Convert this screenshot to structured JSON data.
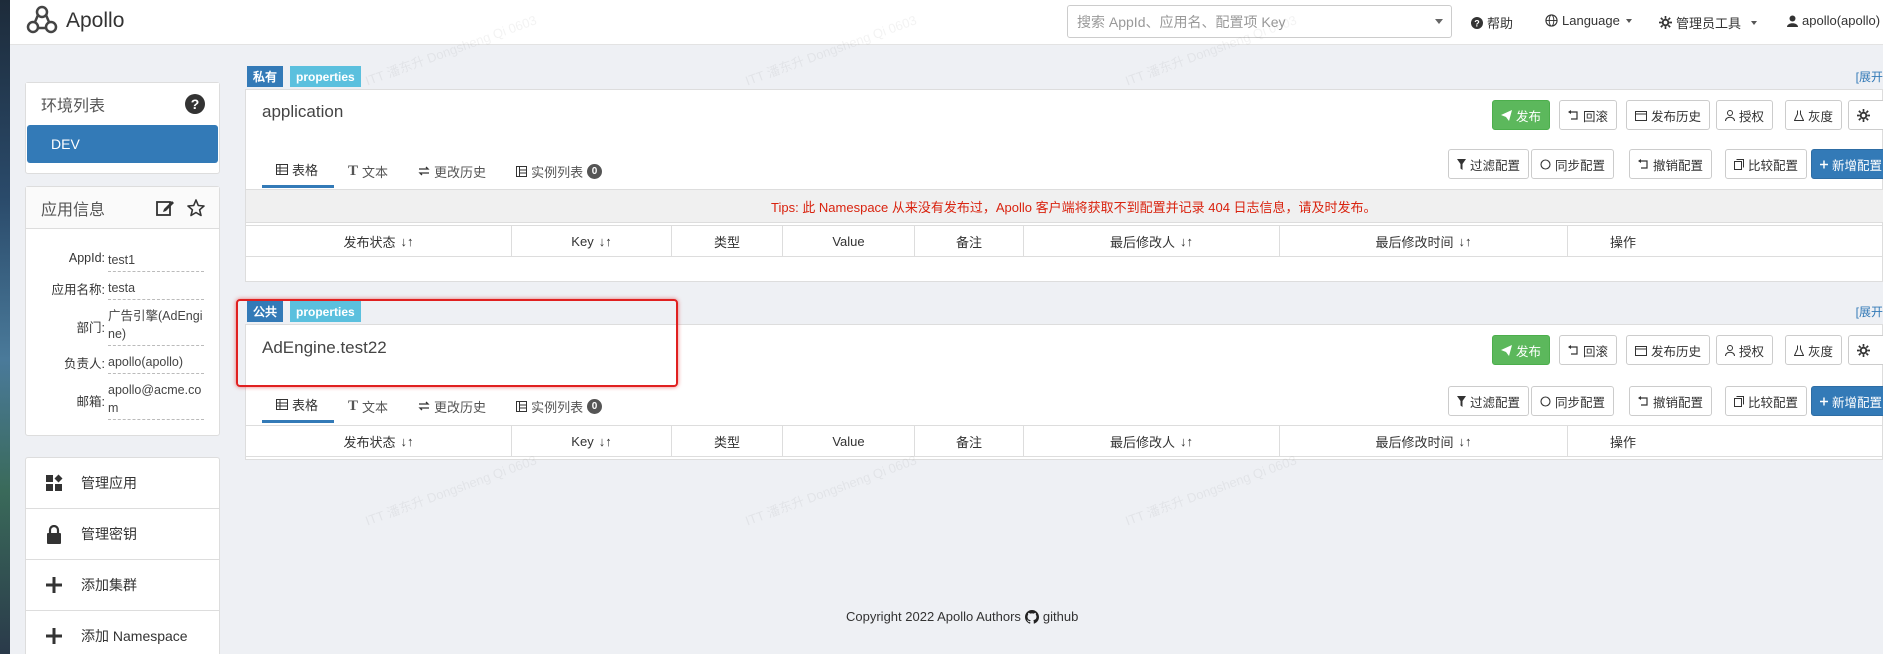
{
  "app": {
    "name": "Apollo"
  },
  "search": {
    "placeholder": "搜索 AppId、应用名、配置项 Key"
  },
  "topnav": {
    "help": "帮助",
    "language": "Language",
    "admin_tools": "管理员工具",
    "user": "apollo(apollo)"
  },
  "env_panel": {
    "title": "环境列表",
    "envs": [
      "DEV"
    ]
  },
  "app_info": {
    "title": "应用信息",
    "rows": [
      {
        "label": "AppId:",
        "value": "test1"
      },
      {
        "label": "应用名称:",
        "value": "testa"
      },
      {
        "label": "部门:",
        "value": "广告引擎(AdEngine)"
      },
      {
        "label": "负责人:",
        "value": "apollo(apollo)"
      },
      {
        "label": "邮箱:",
        "value": "apollo@acme.com"
      }
    ]
  },
  "side_menu": [
    "管理应用",
    "管理密钥",
    "添加集群",
    "添加 Namespace"
  ],
  "namespaces": [
    {
      "scope": "私有",
      "format": "properties",
      "name": "application",
      "tips": "Tips: 此 Namespace 从来没有发布过，Apollo 客户端将获取不到配置并记录 404 日志信息，请及时发布。"
    },
    {
      "scope": "公共",
      "format": "properties",
      "name": "AdEngine.test22",
      "tips": ""
    }
  ],
  "ns_actions": {
    "publish": "发布",
    "rollback": "回滚",
    "history": "发布历史",
    "grant": "授权",
    "gray": "灰度",
    "expand": "[展开"
  },
  "ns_tabs": {
    "table": "表格",
    "text": "文本",
    "change_history": "更改历史",
    "instances": "实例列表",
    "instance_count": "0"
  },
  "table_tools": {
    "filter": "过滤配置",
    "sync": "同步配置",
    "revoke": "撤销配置",
    "diff": "比较配置",
    "add": "新增配置"
  },
  "columns": [
    "发布状态",
    "Key",
    "类型",
    "Value",
    "备注",
    "最后修改人",
    "最后修改时间",
    "操作"
  ],
  "footer": {
    "text": "Copyright 2022 Apollo Authors",
    "link": "github"
  },
  "watermark": "ITT 潘东升 Dongsheng Qi 0603"
}
